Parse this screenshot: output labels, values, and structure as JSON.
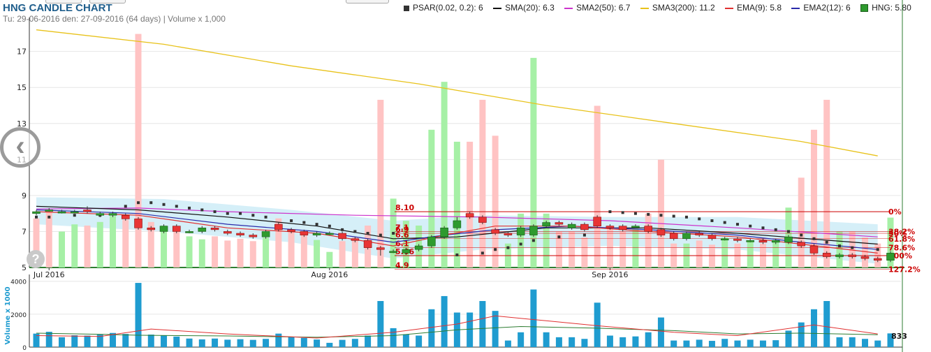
{
  "header": {
    "title": "HNG CANDLE CHART",
    "subtitle": "Tu: 29-06-2016 den: 27-09-2016 (64 days) | Volume x 1,000"
  },
  "legend": [
    {
      "label": "PSAR(0.02, 0.2): 6",
      "color": "#333333",
      "kind": "box"
    },
    {
      "label": "SMA(20): 6.3",
      "color": "#111111",
      "kind": "line"
    },
    {
      "label": "SMA2(50): 6.7",
      "color": "#cc33cc",
      "kind": "line"
    },
    {
      "label": "SMA3(200): 11.2",
      "color": "#e8c21a",
      "kind": "line"
    },
    {
      "label": "EMA(9): 5.8",
      "color": "#e03030",
      "kind": "line"
    },
    {
      "label": "EMA2(12): 6",
      "color": "#2a2aaa",
      "kind": "line"
    },
    {
      "label": "HNG: 5.80",
      "color": "#2e9a2e",
      "kind": "green"
    }
  ],
  "colors": {
    "up": "#2e9a2e",
    "down": "#e83535",
    "vol_bar": "#1f9cd0",
    "fib": "#cc0000",
    "band": "#c7e9f6"
  },
  "fib_labels": [
    {
      "price": 8.1,
      "left": "8.10",
      "right": "0%"
    },
    {
      "price": 7.0,
      "left": "7.1",
      "right": "38.2%"
    },
    {
      "price": 6.9,
      "left": "6.9",
      "right": "50%"
    },
    {
      "price": 6.6,
      "left": "6.6",
      "right": "61.8%"
    },
    {
      "price": 6.1,
      "left": "6.1",
      "right": "78.6%"
    },
    {
      "price": 5.66,
      "left": "5.66",
      "right": "100%"
    },
    {
      "price": 4.9,
      "left": "4.9",
      "right": "127.2%"
    }
  ],
  "volume_axis_label": "Volume x 1000",
  "volume_last": "833",
  "chart_data": {
    "type": "candlestick",
    "price_axis": {
      "ticks": [
        5,
        7,
        9,
        11,
        13,
        15,
        17
      ],
      "ylim": [
        5,
        18.5
      ]
    },
    "volume_axis": {
      "ticks": [
        0,
        2000,
        4000
      ],
      "ylim": [
        0,
        4200
      ]
    },
    "x_labels": [
      {
        "index": 1,
        "label": "Jul 2016"
      },
      {
        "index": 23,
        "label": "Aug 2016"
      },
      {
        "index": 45,
        "label": "Sep 2016"
      }
    ],
    "candles": [
      {
        "o": 8.0,
        "c": 8.1,
        "h": 8.2,
        "l": 7.9,
        "v": 820,
        "vol_color": "red"
      },
      {
        "o": 8.2,
        "c": 8.2,
        "h": 8.3,
        "l": 8.1,
        "v": 930,
        "vol_color": "red"
      },
      {
        "o": 8.1,
        "c": 8.1,
        "h": 8.2,
        "l": 8.0,
        "v": 600,
        "vol_color": "green"
      },
      {
        "o": 8.1,
        "c": 8.1,
        "h": 8.2,
        "l": 8.0,
        "v": 720,
        "vol_color": "green"
      },
      {
        "o": 8.2,
        "c": 8.1,
        "h": 8.4,
        "l": 8.0,
        "v": 700,
        "vol_color": "red"
      },
      {
        "o": 7.9,
        "c": 8.0,
        "h": 8.1,
        "l": 7.8,
        "v": 760,
        "vol_color": "green"
      },
      {
        "o": 7.9,
        "c": 8.0,
        "h": 8.1,
        "l": 7.8,
        "v": 860,
        "vol_color": "green"
      },
      {
        "o": 7.9,
        "c": 7.7,
        "h": 8.0,
        "l": 7.6,
        "v": 800,
        "vol_color": "red"
      },
      {
        "o": 7.7,
        "c": 7.2,
        "h": 7.8,
        "l": 7.1,
        "v": 3900,
        "vol_color": "red"
      },
      {
        "o": 7.2,
        "c": 7.1,
        "h": 7.3,
        "l": 7.0,
        "v": 760,
        "vol_color": "red"
      },
      {
        "o": 7.0,
        "c": 7.3,
        "h": 7.4,
        "l": 6.9,
        "v": 700,
        "vol_color": "green"
      },
      {
        "o": 7.3,
        "c": 7.0,
        "h": 7.4,
        "l": 6.9,
        "v": 640,
        "vol_color": "red"
      },
      {
        "o": 7.0,
        "c": 7.0,
        "h": 7.1,
        "l": 6.9,
        "v": 520,
        "vol_color": "green"
      },
      {
        "o": 7.0,
        "c": 7.2,
        "h": 7.3,
        "l": 6.9,
        "v": 470,
        "vol_color": "green"
      },
      {
        "o": 7.2,
        "c": 7.1,
        "h": 7.3,
        "l": 7.0,
        "v": 520,
        "vol_color": "red"
      },
      {
        "o": 7.0,
        "c": 6.9,
        "h": 7.1,
        "l": 6.8,
        "v": 450,
        "vol_color": "red"
      },
      {
        "o": 6.9,
        "c": 6.8,
        "h": 7.0,
        "l": 6.7,
        "v": 480,
        "vol_color": "red"
      },
      {
        "o": 6.8,
        "c": 6.7,
        "h": 6.9,
        "l": 6.6,
        "v": 440,
        "vol_color": "red"
      },
      {
        "o": 6.7,
        "c": 7.0,
        "h": 7.1,
        "l": 6.6,
        "v": 500,
        "vol_color": "green"
      },
      {
        "o": 7.4,
        "c": 7.1,
        "h": 7.5,
        "l": 7.0,
        "v": 820,
        "vol_color": "red"
      },
      {
        "o": 7.1,
        "c": 7.0,
        "h": 7.2,
        "l": 6.9,
        "v": 620,
        "vol_color": "red"
      },
      {
        "o": 7.0,
        "c": 6.8,
        "h": 7.1,
        "l": 6.7,
        "v": 560,
        "vol_color": "red"
      },
      {
        "o": 6.8,
        "c": 6.9,
        "h": 7.0,
        "l": 6.7,
        "v": 460,
        "vol_color": "green"
      },
      {
        "o": 6.9,
        "c": 6.9,
        "h": 7.0,
        "l": 6.8,
        "v": 260,
        "vol_color": "green"
      },
      {
        "o": 6.9,
        "c": 6.6,
        "h": 7.0,
        "l": 6.5,
        "v": 440,
        "vol_color": "red"
      },
      {
        "o": 6.6,
        "c": 6.5,
        "h": 6.7,
        "l": 6.4,
        "v": 500,
        "vol_color": "red"
      },
      {
        "o": 6.5,
        "c": 6.1,
        "h": 6.6,
        "l": 6.0,
        "v": 700,
        "vol_color": "red"
      },
      {
        "o": 6.1,
        "c": 6.0,
        "h": 6.2,
        "l": 5.66,
        "v": 2800,
        "vol_color": "red"
      },
      {
        "o": 5.9,
        "c": 5.9,
        "h": 6.0,
        "l": 5.8,
        "v": 1150,
        "vol_color": "green"
      },
      {
        "o": 5.8,
        "c": 6.0,
        "h": 6.1,
        "l": 5.7,
        "v": 780,
        "vol_color": "green"
      },
      {
        "o": 6.0,
        "c": 6.2,
        "h": 6.3,
        "l": 5.9,
        "v": 700,
        "vol_color": "green"
      },
      {
        "o": 6.2,
        "c": 6.7,
        "h": 6.8,
        "l": 6.1,
        "v": 2300,
        "vol_color": "green"
      },
      {
        "o": 6.7,
        "c": 7.2,
        "h": 7.3,
        "l": 6.6,
        "v": 3100,
        "vol_color": "green"
      },
      {
        "o": 7.2,
        "c": 7.6,
        "h": 7.8,
        "l": 7.1,
        "v": 2100,
        "vol_color": "green"
      },
      {
        "o": 8.0,
        "c": 7.8,
        "h": 8.1,
        "l": 7.7,
        "v": 2100,
        "vol_color": "red"
      },
      {
        "o": 7.8,
        "c": 7.5,
        "h": 7.9,
        "l": 7.4,
        "v": 2800,
        "vol_color": "red"
      },
      {
        "o": 7.1,
        "c": 6.9,
        "h": 7.2,
        "l": 6.8,
        "v": 2200,
        "vol_color": "red"
      },
      {
        "o": 6.9,
        "c": 6.8,
        "h": 7.0,
        "l": 6.7,
        "v": 400,
        "vol_color": "green"
      },
      {
        "o": 6.8,
        "c": 7.2,
        "h": 7.3,
        "l": 6.7,
        "v": 900,
        "vol_color": "green"
      },
      {
        "o": 6.8,
        "c": 7.3,
        "h": 7.4,
        "l": 6.7,
        "v": 3500,
        "vol_color": "green"
      },
      {
        "o": 7.3,
        "c": 7.5,
        "h": 7.6,
        "l": 7.2,
        "v": 900,
        "vol_color": "green"
      },
      {
        "o": 7.5,
        "c": 7.4,
        "h": 7.6,
        "l": 7.3,
        "v": 600,
        "vol_color": "red"
      },
      {
        "o": 7.2,
        "c": 7.4,
        "h": 7.5,
        "l": 7.1,
        "v": 600,
        "vol_color": "red"
      },
      {
        "o": 7.4,
        "c": 7.1,
        "h": 7.5,
        "l": 7.0,
        "v": 500,
        "vol_color": "red"
      },
      {
        "o": 7.8,
        "c": 7.3,
        "h": 7.9,
        "l": 7.2,
        "v": 2700,
        "vol_color": "red"
      },
      {
        "o": 7.3,
        "c": 7.2,
        "h": 7.4,
        "l": 7.1,
        "v": 700,
        "vol_color": "red"
      },
      {
        "o": 7.3,
        "c": 7.1,
        "h": 7.4,
        "l": 7.0,
        "v": 600,
        "vol_color": "red"
      },
      {
        "o": 7.3,
        "c": 7.3,
        "h": 7.4,
        "l": 7.2,
        "v": 650,
        "vol_color": "green"
      },
      {
        "o": 7.3,
        "c": 7.0,
        "h": 7.4,
        "l": 6.9,
        "v": 900,
        "vol_color": "red"
      },
      {
        "o": 7.1,
        "c": 6.8,
        "h": 7.2,
        "l": 6.7,
        "v": 1800,
        "vol_color": "red"
      },
      {
        "o": 6.9,
        "c": 6.6,
        "h": 7.0,
        "l": 6.5,
        "v": 400,
        "vol_color": "red"
      },
      {
        "o": 6.6,
        "c": 6.9,
        "h": 7.0,
        "l": 6.5,
        "v": 400,
        "vol_color": "green"
      },
      {
        "o": 6.9,
        "c": 6.8,
        "h": 7.0,
        "l": 6.7,
        "v": 450,
        "vol_color": "red"
      },
      {
        "o": 6.8,
        "c": 6.6,
        "h": 6.9,
        "l": 6.5,
        "v": 380,
        "vol_color": "red"
      },
      {
        "o": 6.6,
        "c": 6.6,
        "h": 6.7,
        "l": 6.5,
        "v": 500,
        "vol_color": "green"
      },
      {
        "o": 6.6,
        "c": 6.5,
        "h": 6.7,
        "l": 6.4,
        "v": 400,
        "vol_color": "red"
      },
      {
        "o": 6.5,
        "c": 6.5,
        "h": 6.6,
        "l": 6.4,
        "v": 450,
        "vol_color": "green"
      },
      {
        "o": 6.5,
        "c": 6.4,
        "h": 6.6,
        "l": 6.3,
        "v": 400,
        "vol_color": "red"
      },
      {
        "o": 6.4,
        "c": 6.5,
        "h": 6.6,
        "l": 6.3,
        "v": 420,
        "vol_color": "green"
      },
      {
        "o": 6.4,
        "c": 6.7,
        "h": 6.8,
        "l": 6.3,
        "v": 1000,
        "vol_color": "green"
      },
      {
        "o": 6.4,
        "c": 6.2,
        "h": 6.5,
        "l": 6.1,
        "v": 1500,
        "vol_color": "red"
      },
      {
        "o": 6.2,
        "c": 5.8,
        "h": 6.3,
        "l": 5.7,
        "v": 2300,
        "vol_color": "red"
      },
      {
        "o": 5.8,
        "c": 5.6,
        "h": 5.9,
        "l": 5.5,
        "v": 2800,
        "vol_color": "red"
      },
      {
        "o": 5.6,
        "c": 5.7,
        "h": 5.8,
        "l": 5.5,
        "v": 600,
        "vol_color": "green"
      },
      {
        "o": 5.7,
        "c": 5.6,
        "h": 5.8,
        "l": 5.5,
        "v": 600,
        "vol_color": "red"
      },
      {
        "o": 5.6,
        "c": 5.5,
        "h": 5.7,
        "l": 5.4,
        "v": 500,
        "vol_color": "red"
      },
      {
        "o": 5.5,
        "c": 5.4,
        "h": 5.6,
        "l": 5.3,
        "v": 400,
        "vol_color": "red"
      },
      {
        "o": 5.4,
        "c": 5.8,
        "h": 5.9,
        "l": 5.3,
        "v": 833,
        "vol_color": "green"
      }
    ],
    "sma200": [
      [
        0,
        18.2
      ],
      [
        10,
        17.4
      ],
      [
        20,
        16.2
      ],
      [
        30,
        15.2
      ],
      [
        40,
        14.0
      ],
      [
        50,
        13.0
      ],
      [
        60,
        12.0
      ],
      [
        66,
        11.2
      ]
    ],
    "sma50": [
      [
        0,
        8.25
      ],
      [
        8,
        8.3
      ],
      [
        15,
        8.1
      ],
      [
        25,
        7.9
      ],
      [
        35,
        7.8
      ],
      [
        45,
        7.6
      ],
      [
        55,
        7.2
      ],
      [
        66,
        6.7
      ]
    ],
    "sma20": [
      [
        0,
        8.4
      ],
      [
        8,
        8.2
      ],
      [
        15,
        7.8
      ],
      [
        22,
        7.3
      ],
      [
        28,
        6.6
      ],
      [
        33,
        6.7
      ],
      [
        40,
        7.2
      ],
      [
        48,
        7.2
      ],
      [
        55,
        6.9
      ],
      [
        66,
        6.3
      ]
    ],
    "ema9": [
      [
        0,
        8.1
      ],
      [
        8,
        7.9
      ],
      [
        15,
        7.2
      ],
      [
        22,
        6.9
      ],
      [
        28,
        6.2
      ],
      [
        32,
        6.8
      ],
      [
        36,
        7.3
      ],
      [
        42,
        7.3
      ],
      [
        48,
        7.0
      ],
      [
        55,
        6.7
      ],
      [
        60,
        6.3
      ],
      [
        66,
        5.8
      ]
    ],
    "ema12": [
      [
        0,
        8.2
      ],
      [
        8,
        8.0
      ],
      [
        15,
        7.4
      ],
      [
        22,
        7.0
      ],
      [
        28,
        6.4
      ],
      [
        32,
        6.8
      ],
      [
        36,
        7.1
      ],
      [
        42,
        7.3
      ],
      [
        48,
        7.1
      ],
      [
        55,
        6.8
      ],
      [
        60,
        6.4
      ],
      [
        66,
        6.0
      ]
    ],
    "psar": [
      [
        0,
        7.8
      ],
      [
        1,
        7.8
      ],
      [
        3,
        7.9
      ],
      [
        5,
        7.9
      ],
      [
        7,
        8.4
      ],
      [
        8,
        8.6
      ],
      [
        9,
        8.6
      ],
      [
        10,
        8.5
      ],
      [
        11,
        8.4
      ],
      [
        12,
        8.3
      ],
      [
        13,
        8.2
      ],
      [
        14,
        8.1
      ],
      [
        15,
        8.0
      ],
      [
        16,
        8.0
      ],
      [
        17,
        7.9
      ],
      [
        18,
        7.8
      ],
      [
        20,
        7.6
      ],
      [
        21,
        7.5
      ],
      [
        22,
        7.4
      ],
      [
        23,
        7.3
      ],
      [
        24,
        7.1
      ],
      [
        25,
        7.0
      ],
      [
        26,
        6.9
      ],
      [
        27,
        6.8
      ],
      [
        28,
        6.9
      ],
      [
        33,
        5.7
      ],
      [
        35,
        5.8
      ],
      [
        36,
        6.0
      ],
      [
        37,
        6.1
      ],
      [
        38,
        6.3
      ],
      [
        39,
        6.5
      ],
      [
        41,
        6.7
      ],
      [
        43,
        6.8
      ],
      [
        45,
        8.1
      ],
      [
        46,
        8.05
      ],
      [
        47,
        8.0
      ],
      [
        48,
        7.95
      ],
      [
        49,
        7.9
      ],
      [
        50,
        7.85
      ],
      [
        51,
        7.8
      ],
      [
        52,
        7.7
      ],
      [
        53,
        7.6
      ],
      [
        54,
        7.5
      ],
      [
        55,
        7.4
      ],
      [
        56,
        7.3
      ],
      [
        57,
        7.2
      ],
      [
        58,
        7.1
      ],
      [
        59,
        7.0
      ],
      [
        60,
        6.8
      ],
      [
        61,
        6.6
      ],
      [
        62,
        6.4
      ],
      [
        63,
        6.2
      ],
      [
        64,
        6.1
      ],
      [
        66,
        6.0
      ]
    ],
    "band_upper": [
      [
        0,
        8.9
      ],
      [
        10,
        8.8
      ],
      [
        20,
        8.2
      ],
      [
        28,
        7.6
      ],
      [
        35,
        7.9
      ],
      [
        45,
        7.8
      ],
      [
        55,
        7.8
      ],
      [
        66,
        7.4
      ]
    ],
    "band_lower": [
      [
        0,
        7.4
      ],
      [
        10,
        7.0
      ],
      [
        20,
        6.4
      ],
      [
        28,
        5.5
      ],
      [
        35,
        6.0
      ],
      [
        45,
        6.2
      ],
      [
        55,
        6.0
      ],
      [
        66,
        5.2
      ]
    ],
    "vol_sma": [
      [
        0,
        850
      ],
      [
        5,
        780
      ],
      [
        8,
        720
      ],
      [
        15,
        680
      ],
      [
        22,
        600
      ],
      [
        28,
        700
      ],
      [
        33,
        1050
      ],
      [
        38,
        1250
      ],
      [
        44,
        1150
      ],
      [
        50,
        1000
      ],
      [
        55,
        800
      ],
      [
        60,
        850
      ],
      [
        66,
        750
      ]
    ],
    "vol_ema": [
      [
        0,
        700
      ],
      [
        5,
        650
      ],
      [
        9,
        1100
      ],
      [
        15,
        800
      ],
      [
        22,
        550
      ],
      [
        28,
        900
      ],
      [
        33,
        1400
      ],
      [
        36,
        1900
      ],
      [
        40,
        1600
      ],
      [
        44,
        1300
      ],
      [
        50,
        900
      ],
      [
        55,
        700
      ],
      [
        61,
        1350
      ],
      [
        66,
        800
      ]
    ]
  }
}
